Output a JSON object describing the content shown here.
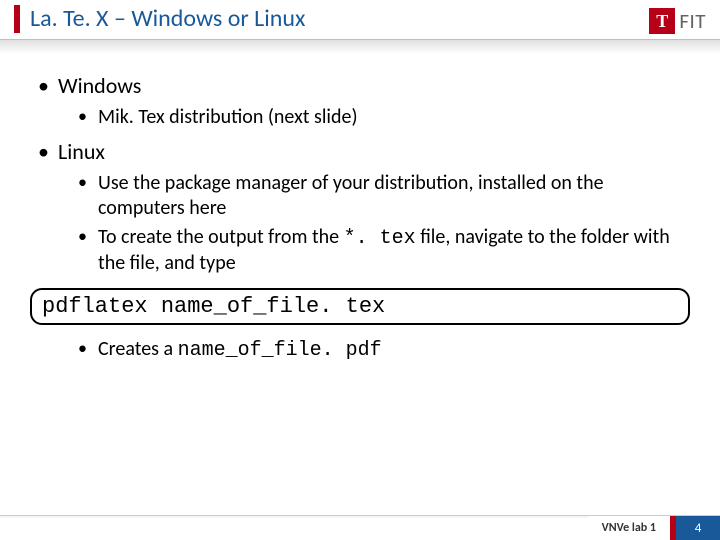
{
  "title": "La. Te. X – Windows or Linux",
  "logo": {
    "t": "T",
    "fit": "FIT"
  },
  "bullets": {
    "windows": "Windows",
    "windows_sub": "Mik. Tex distribution (next slide)",
    "linux": "Linux",
    "linux_sub1_a": "Use the package manager of your distribution, installed on the computers here",
    "linux_sub2_a": "To create the output from the ",
    "linux_sub2_code": "*. tex",
    "linux_sub2_b": " file, navigate to the folder with the file, and type",
    "creates_a": "Creates a ",
    "creates_code": "name_of_file. pdf"
  },
  "command": "pdflatex name_of_file. tex",
  "footer": {
    "label": "VNVe lab 1",
    "page": "4"
  }
}
